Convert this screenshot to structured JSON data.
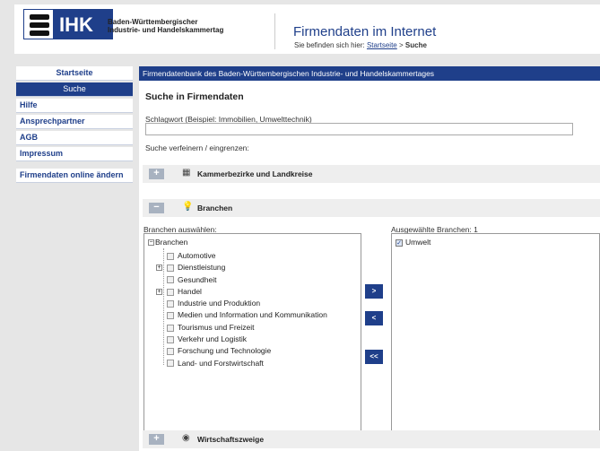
{
  "header": {
    "logo_text": "IHK",
    "org_line1": "Baden-Württembergischer",
    "org_line2": "Industrie- und Handelskammertag",
    "site_title": "Firmendaten im Internet",
    "breadcrumb_prefix": "Sie befinden sich hier:",
    "breadcrumb_link": "Startseite",
    "breadcrumb_sep": ">",
    "breadcrumb_current": "Suche"
  },
  "sidebar": {
    "items": [
      {
        "label": "Startseite"
      },
      {
        "label": "Suche"
      },
      {
        "label": "Hilfe"
      },
      {
        "label": "Ansprechpartner"
      },
      {
        "label": "AGB"
      },
      {
        "label": "Impressum"
      },
      {
        "label": "Firmendaten online ändern"
      }
    ]
  },
  "main": {
    "header": "Firmendatenbank des Baden-Württembergischen Industrie- und Handelskammertages",
    "title": "Suche in Firmendaten",
    "keyword_label": "Schlagwort (Beispiel: Immobilien, Umwelttechnik)",
    "keyword_value": "",
    "refine_label": "Suche verfeinern / eingrenzen:",
    "sections": [
      {
        "toggle": "+",
        "icon": "building-icon",
        "title": "Kammerbezirke und Landkreise"
      },
      {
        "toggle": "−",
        "icon": "lightbulb-icon",
        "title": "Branchen"
      },
      {
        "toggle": "+",
        "icon": "globe-icon",
        "title": "Wirtschaftszweige"
      }
    ],
    "branchen": {
      "select_label": "Branchen auswählen:",
      "selected_label": "Ausgewählte Branchen: 1",
      "tree_root": "Branchen",
      "tree_items": [
        {
          "label": "Automotive"
        },
        {
          "label": "Dienstleistung"
        },
        {
          "label": "Gesundheit"
        },
        {
          "label": "Handel"
        },
        {
          "label": "Industrie und Produktion"
        },
        {
          "label": "Medien und Information und Kommunikation"
        },
        {
          "label": "Tourismus und Freizeit"
        },
        {
          "label": "Verkehr und Logistik"
        },
        {
          "label": "Forschung und Technologie"
        },
        {
          "label": "Land- und Forstwirtschaft"
        }
      ],
      "buttons": {
        "add": ">",
        "remove": "<",
        "remove_all": "<<"
      },
      "selected_items": [
        {
          "label": "Umwelt"
        }
      ]
    }
  },
  "colors": {
    "brand": "#1f3f8a",
    "accordion_bg": "#eeeeee",
    "page_bg": "#e6e6e6"
  }
}
